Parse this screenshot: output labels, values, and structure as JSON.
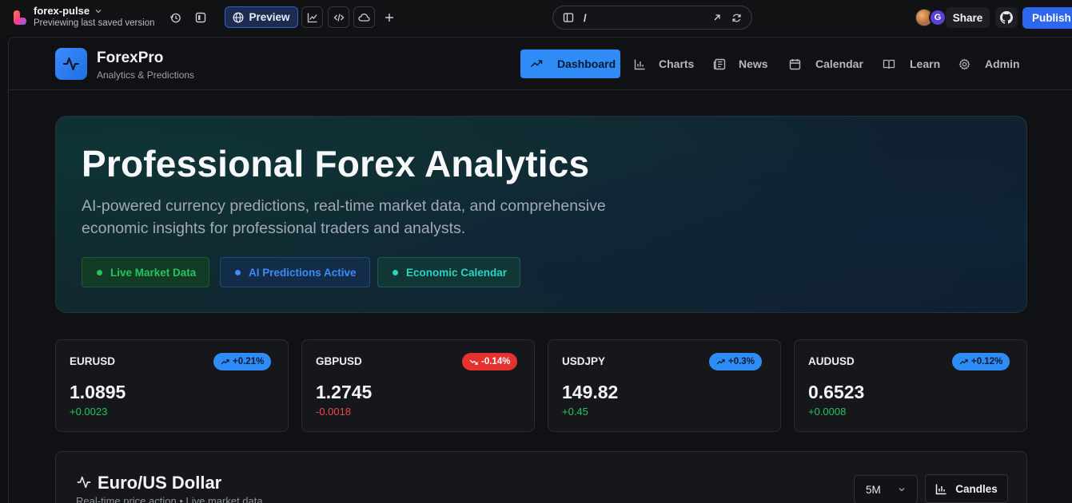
{
  "editor": {
    "project_name": "forex-pulse",
    "project_status": "Previewing last saved version",
    "preview_label": "Preview",
    "url_path": "/",
    "avatar_letter": "G",
    "share_label": "Share",
    "publish_label": "Publish"
  },
  "app": {
    "brand_name": "ForexPro",
    "brand_tagline": "Analytics & Predictions",
    "nav": [
      {
        "label": "Dashboard",
        "icon": "trending-up-icon",
        "active": true
      },
      {
        "label": "Charts",
        "icon": "bar-chart-icon"
      },
      {
        "label": "News",
        "icon": "newspaper-icon"
      },
      {
        "label": "Calendar",
        "icon": "calendar-icon"
      },
      {
        "label": "Learn",
        "icon": "book-open-icon"
      },
      {
        "label": "Admin",
        "icon": "gear-icon"
      }
    ]
  },
  "hero": {
    "title": "Professional Forex Analytics",
    "description": "AI-powered currency predictions, real-time market data, and comprehensive economic insights for professional traders and analysts.",
    "chips": [
      {
        "label": "Live Market Data",
        "color": "#22c55e"
      },
      {
        "label": "AI Predictions Active",
        "color": "#3b8cf6"
      },
      {
        "label": "Economic Calendar",
        "color": "#2dd4bf"
      }
    ]
  },
  "pairs": [
    {
      "symbol": "EURUSD",
      "price": "1.0895",
      "change": "+0.0023",
      "percent": "+0.21%",
      "direction": "up"
    },
    {
      "symbol": "GBPUSD",
      "price": "1.2745",
      "change": "-0.0018",
      "percent": "-0.14%",
      "direction": "down"
    },
    {
      "symbol": "USDJPY",
      "price": "149.82",
      "change": "+0.45",
      "percent": "+0.3%",
      "direction": "up"
    },
    {
      "symbol": "AUDUSD",
      "price": "0.6523",
      "change": "+0.0008",
      "percent": "+0.12%",
      "direction": "up"
    }
  ],
  "chart_section": {
    "title": "Euro/US Dollar",
    "subtitle": "Real-time price action • Live market data",
    "timeframe": "5M",
    "mode_label": "Candles"
  },
  "colors": {
    "accent": "#2f8cf7",
    "positive": "#22c55e",
    "negative": "#ef4444",
    "publish": "#2f66f0"
  }
}
